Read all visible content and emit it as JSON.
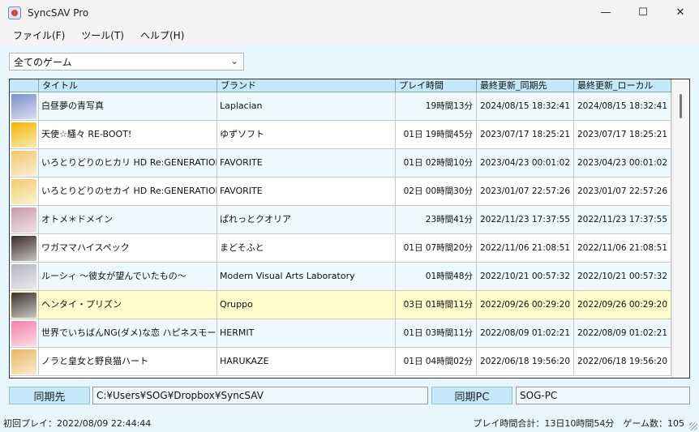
{
  "window": {
    "title": "SyncSAV Pro"
  },
  "menu": [
    {
      "label": "ファイル(F)"
    },
    {
      "label": "ツール(T)"
    },
    {
      "label": "ヘルプ(H)"
    }
  ],
  "filter": {
    "selected": "全てのゲーム"
  },
  "grid": {
    "columns": [
      "",
      "タイトル",
      "ブランド",
      "プレイ時間",
      "最終更新_同期先",
      "最終更新_ローカル"
    ],
    "rows": [
      {
        "title": "白昼夢の青写真",
        "brand": "Laplacian",
        "playtime": "19時間13分",
        "synced": "2024/08/15 18:32:41",
        "local": "2024/08/15 18:32:41",
        "thumb_color": "#7d8fc9"
      },
      {
        "title": "天使☆騒々 RE-BOOT!",
        "brand": "ゆずソフト",
        "playtime": "01日 19時間45分",
        "synced": "2023/07/17 18:25:21",
        "local": "2023/07/17 18:25:21",
        "thumb_color": "#f4b400"
      },
      {
        "title": "いろとりどりのヒカリ HD Re:GENERATION",
        "brand": "FAVORITE",
        "playtime": "01日 02時間10分",
        "synced": "2023/04/23 00:01:02",
        "local": "2023/04/23 00:01:02",
        "thumb_color": "#f2c66b"
      },
      {
        "title": "いろとりどりのセカイ HD Re:GENERATION",
        "brand": "FAVORITE",
        "playtime": "02日 00時間30分",
        "synced": "2023/01/07 22:57:26",
        "local": "2023/01/07 22:57:26",
        "thumb_color": "#f1cd6a"
      },
      {
        "title": "オトメ＊ドメイン",
        "brand": "ぱれっとクオリア",
        "playtime": "23時間41分",
        "synced": "2022/11/23 17:37:55",
        "local": "2022/11/23 17:37:55",
        "thumb_color": "#c79aa8"
      },
      {
        "title": "ワガママハイスペック",
        "brand": "まどそふと",
        "playtime": "01日 07時間20分",
        "synced": "2022/11/06 21:08:51",
        "local": "2022/11/06 21:08:51",
        "thumb_color": "#3a2a2a"
      },
      {
        "title": "ルーシィ 〜彼女が望んでいたもの〜",
        "brand": "Modern Visual Arts Laboratory",
        "playtime": "01時間48分",
        "synced": "2022/10/21 00:57:32",
        "local": "2022/10/21 00:57:32",
        "thumb_color": "#b5b5c0"
      },
      {
        "title": "ヘンタイ・プリズン",
        "brand": "Qruppo",
        "playtime": "03日 01時間11分",
        "synced": "2022/09/26 00:29:20",
        "local": "2022/09/26 00:29:20",
        "thumb_color": "#3b3430"
      },
      {
        "title": "世界でいちばんNG(ダメ)な恋 ハピネスモーション",
        "brand": "HERMIT",
        "playtime": "01日 03時間11分",
        "synced": "2022/08/09 01:02:21",
        "local": "2022/08/09 01:02:21",
        "thumb_color": "#f47fa8"
      },
      {
        "title": "ノラと皇女と野良猫ハート",
        "brand": "HARUKAZE",
        "playtime": "01日 04時間02分",
        "synced": "2022/06/18 19:56:20",
        "local": "2022/06/18 19:56:20",
        "thumb_color": "#e8b860"
      }
    ]
  },
  "sync": {
    "dest_label": "同期先",
    "dest_path": "C:¥Users¥SOG¥Dropbox¥SyncSAV",
    "pc_label": "同期PC",
    "pc_name": "SOG-PC"
  },
  "status": {
    "first_play": "初回プレイ：2022/08/09 22:44:44",
    "summary": "プレイ時間合計：13日10時間54分　ゲーム数：105"
  }
}
